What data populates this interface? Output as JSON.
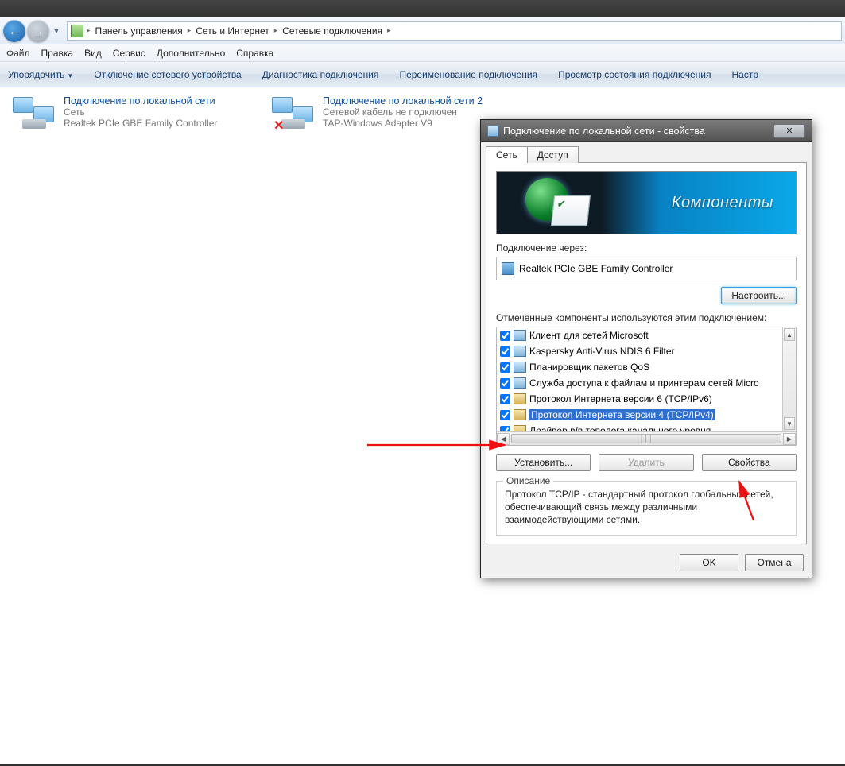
{
  "breadcrumb": {
    "items": [
      "Панель управления",
      "Сеть и Интернет",
      "Сетевые подключения"
    ]
  },
  "menu": {
    "file": "Файл",
    "edit": "Правка",
    "view": "Вид",
    "tools": "Сервис",
    "extra": "Дополнительно",
    "help": "Справка"
  },
  "cmdbar": {
    "organize": "Упорядочить",
    "disable": "Отключение сетевого устройства",
    "diag": "Диагностика подключения",
    "rename": "Переименование подключения",
    "status": "Просмотр состояния подключения",
    "settings": "Настр"
  },
  "connections": [
    {
      "title": "Подключение по локальной сети",
      "status": "Сеть",
      "device": "Realtek PCIe GBE Family Controller",
      "disconnected": false
    },
    {
      "title": "Подключение по локальной сети 2",
      "status": "Сетевой кабель не подключен",
      "device": "TAP-Windows Adapter V9",
      "disconnected": true
    }
  ],
  "dlg": {
    "title": "Подключение по локальной сети - свойства",
    "tabs": {
      "net": "Сеть",
      "access": "Доступ"
    },
    "banner": "Компоненты",
    "connect_via": "Подключение через:",
    "adapter": "Realtek PCIe GBE Family Controller",
    "configure": "Настроить...",
    "checked_label": "Отмеченные компоненты используются этим подключением:",
    "components": [
      {
        "checked": true,
        "label": "Клиент для сетей Microsoft",
        "sel": false
      },
      {
        "checked": true,
        "label": "Kaspersky Anti-Virus NDIS 6 Filter",
        "sel": false
      },
      {
        "checked": true,
        "label": "Планировщик пакетов QoS",
        "sel": false
      },
      {
        "checked": true,
        "label": "Служба доступа к файлам и принтерам сетей Micro",
        "sel": false
      },
      {
        "checked": true,
        "label": "Протокол Интернета версии 6 (TCP/IPv6)",
        "sel": false,
        "yellow": true
      },
      {
        "checked": true,
        "label": "Протокол Интернета версии 4 (TCP/IPv4)",
        "sel": true,
        "yellow": true
      },
      {
        "checked": true,
        "label": "Драйвер в/в тополога канального уровня",
        "sel": false,
        "yellow": true
      }
    ],
    "install": "Установить...",
    "remove": "Удалить",
    "props": "Свойства",
    "desc_legend": "Описание",
    "desc": "Протокол TCP/IP - стандартный протокол глобальных сетей, обеспечивающий связь между различными взаимодействующими сетями.",
    "ok": "OK",
    "cancel": "Отмена"
  }
}
